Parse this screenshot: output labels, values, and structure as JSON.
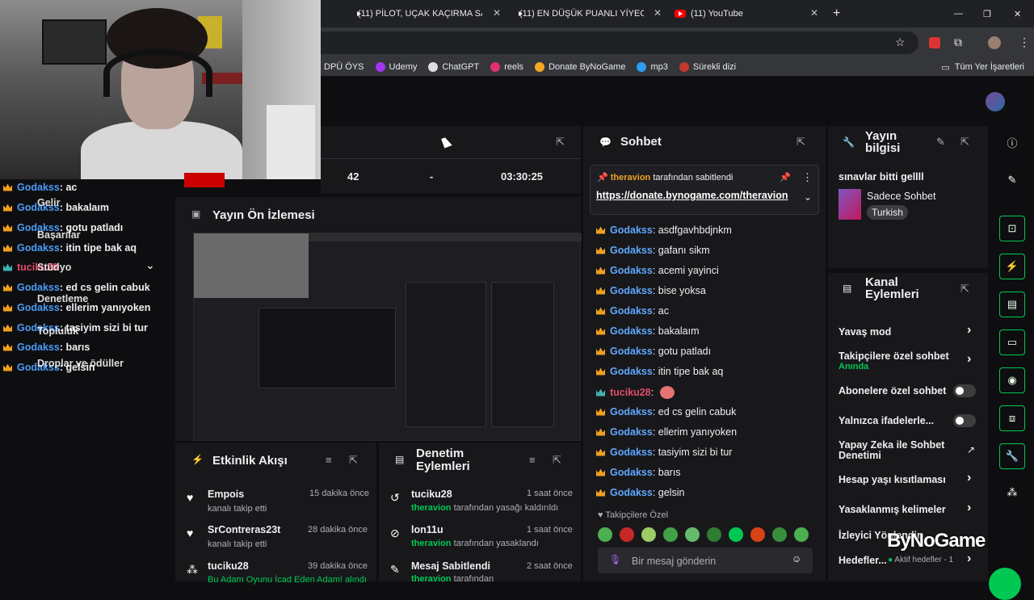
{
  "browser": {
    "tabs": [
      {
        "title": "(11) PİLOT, UÇAK KAÇIRMA SA"
      },
      {
        "title": "(11) EN DÜŞÜK PUANLI YİYECE"
      },
      {
        "title": "(11) YouTube"
      }
    ],
    "new_tab": "+",
    "bookmarks": [
      "DPÜ ÖYS",
      "Udemy",
      "ChatGPT",
      "reels",
      "Donate ByNoGame",
      "mp3",
      "Sürekli dizi"
    ],
    "all_bookmarks": "Tüm Yer İşaretleri"
  },
  "stats": {
    "viewers": "42",
    "dash": "-",
    "uptime": "03:30:25"
  },
  "preview": {
    "title": "Yayın Ön İzlemesi"
  },
  "chat": {
    "title": "Sohbet",
    "pinned_by": "theravion",
    "pinned_suffix": "tarafından sabitlendi",
    "pinned_link": "https://donate.bynogame.com/theravion",
    "messages": [
      {
        "user": "Godakss",
        "text": ": asdfgavhbdjnkm"
      },
      {
        "user": "Godakss",
        "text": ": gafanı sikm"
      },
      {
        "user": "Godakss",
        "text": ": acemi yayinci"
      },
      {
        "user": "Godakss",
        "text": ": bise yoksa"
      },
      {
        "user": "Godakss",
        "text": ": ac"
      },
      {
        "user": "Godakss",
        "text": ": bakalaım"
      },
      {
        "user": "Godakss",
        "text": ": gotu patladı"
      },
      {
        "user": "Godakss",
        "text": ": itin tipe bak aq"
      },
      {
        "user": "tuciku28",
        "text": ":"
      },
      {
        "user": "Godakss",
        "text": ": ed cs gelin cabuk"
      },
      {
        "user": "Godakss",
        "text": ": ellerim yanıyoken"
      },
      {
        "user": "Godakss",
        "text": ": tasiyim sizi bi tur"
      },
      {
        "user": "Godakss",
        "text": ": barıs"
      },
      {
        "user": "Godakss",
        "text": ": gelsin"
      }
    ],
    "followers_only": "Takipçilere Özel",
    "input_placeholder": "Bir mesaj gönderin"
  },
  "stream_info": {
    "title": "Yayın bilgisi",
    "stream_title": "sınavlar bitti gellll",
    "category": "Sadece Sohbet",
    "tag": "Turkish"
  },
  "channel_actions": {
    "title": "Kanal Eylemleri",
    "items": [
      {
        "label": "Yavaş mod"
      },
      {
        "label": "Takipçilere özel sohbet",
        "sub": "Anında"
      },
      {
        "label": "Abonelere özel sohbet"
      },
      {
        "label": "Yalnızca ifadelerle..."
      },
      {
        "label": "Yapay Zeka ile Sohbet Denetimi"
      },
      {
        "label": "Hesap yaşı kısıtlaması"
      },
      {
        "label": "Yasaklanmış kelimeler"
      },
      {
        "label": "İzleyici Yönlendir"
      },
      {
        "label": "Hedefler...",
        "sub": "Aktif hedefler - 1"
      }
    ]
  },
  "activity": {
    "title": "Etkinlik Akışı",
    "items": [
      {
        "user": "Empois",
        "desc": "kanalı takip etti",
        "time": "15 dakika önce"
      },
      {
        "user": "SrContreras23t",
        "desc": "kanalı takip etti",
        "time": "28 dakika önce"
      },
      {
        "user": "tuciku28",
        "desc": "Bu Adam Oyunu İcad Eden Adam! alındı",
        "time": "39 dakika önce"
      }
    ]
  },
  "moderation": {
    "title": "Denetim Eylemleri",
    "items": [
      {
        "user": "tuciku28",
        "actor": "theravion",
        "desc": "tarafından yasağı kaldırıldı",
        "time": "1 saat önce"
      },
      {
        "user": "lon11u",
        "actor": "theravion",
        "desc": "tarafından yasaklandı",
        "time": "1 saat önce"
      },
      {
        "user": "Mesaj Sabitlendi",
        "actor": "theravion",
        "desc": "tarafından",
        "time": "2 saat önce"
      }
    ]
  },
  "overlay": {
    "lines": [
      {
        "user": "Godakss",
        "text": ": ac"
      },
      {
        "user": "Godakss",
        "text": ": bakalaım"
      },
      {
        "user": "Godakss",
        "text": ": gotu patladı"
      },
      {
        "user": "Godakss",
        "text": ": itin tipe bak aq"
      },
      {
        "user": "tuciku28",
        "text": ""
      },
      {
        "user": "Godakss",
        "text": ": ed cs gelin cabuk"
      },
      {
        "user": "Godakss",
        "text": ": ellerim yanıyoken"
      },
      {
        "user": "Godakss",
        "text": ": tasiyim sizi bi tur"
      },
      {
        "user": "Godakss",
        "text": ": barıs"
      },
      {
        "user": "Godakss",
        "text": ": gelsin"
      }
    ],
    "menu": [
      "Gelir",
      "Başarılar",
      "Stüdyo",
      "Denetleme",
      "Topluluk",
      "Droplar ve ödüller"
    ]
  },
  "watermark": "ByNoGame",
  "colors": {
    "accent": "#00c853",
    "username_blue": "#5fa8ff",
    "crown": "#f0a020"
  }
}
